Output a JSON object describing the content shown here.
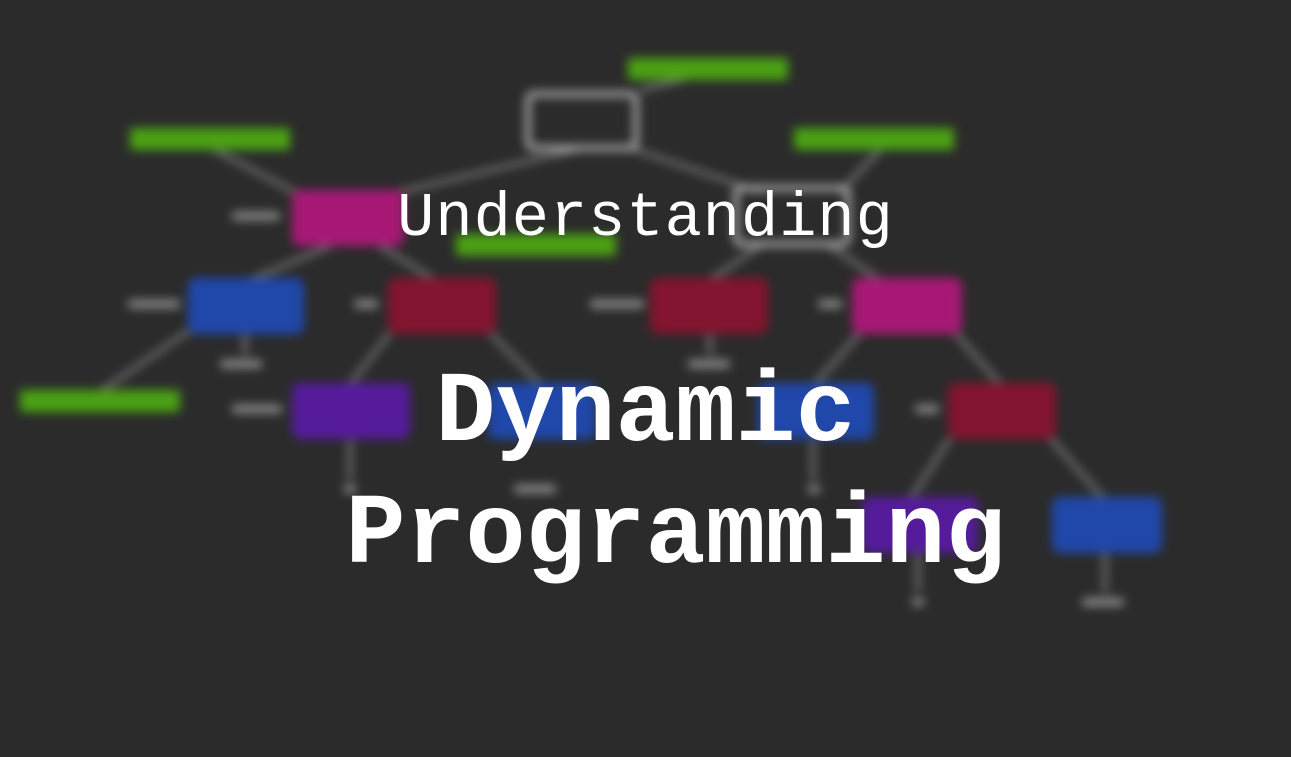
{
  "title": {
    "line1": "Understanding",
    "line2": "Dynamic",
    "line3": "Programming"
  },
  "colors": {
    "background": "#2b2b2b",
    "title_text": "#ffffff",
    "node_outline": "#cfcfcf",
    "node_magenta": "#b5177e",
    "node_crimson": "#8d1230",
    "node_blue": "#1f4bb8",
    "node_purple": "#5a1aa8",
    "memo_label": "#4fae12",
    "edge": "#8a8a8a"
  }
}
